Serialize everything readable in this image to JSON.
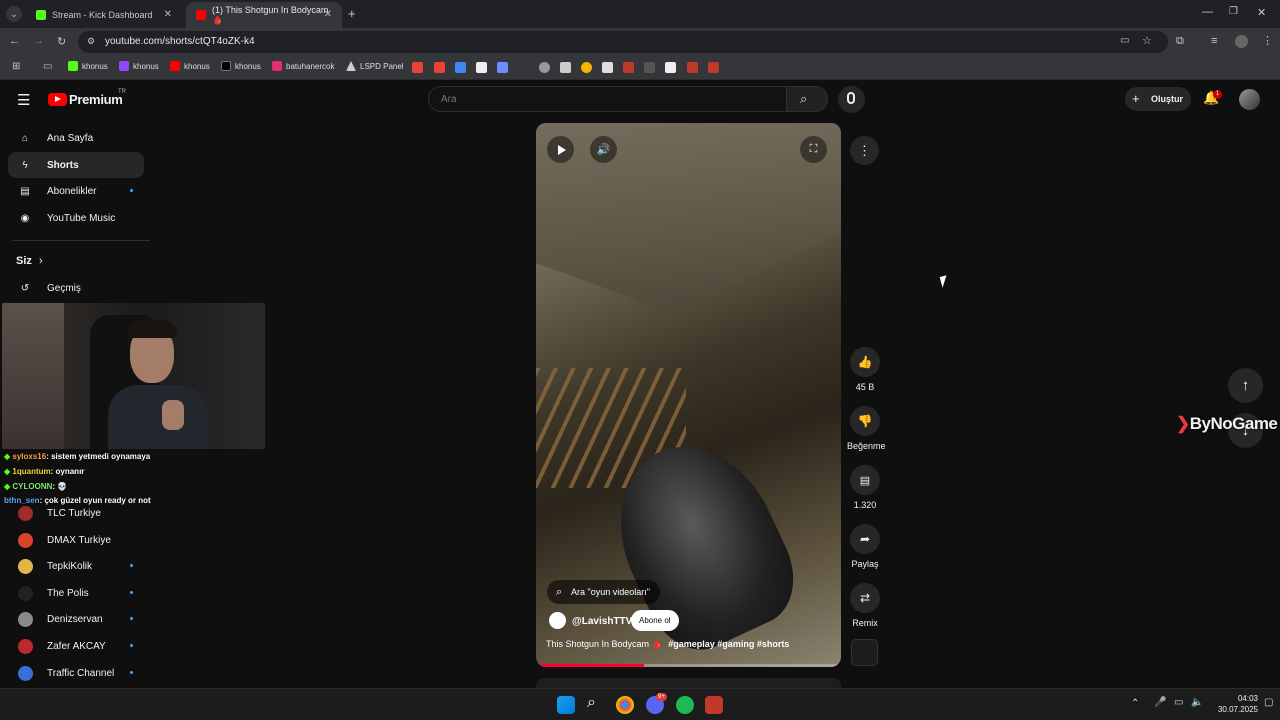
{
  "browser": {
    "tabs": [
      {
        "title": "Stream - Kick Dashboard",
        "color": "#53fc18"
      },
      {
        "title": "(1) This Shotgun In Bodycam 🩸",
        "color": "#ff0000"
      }
    ],
    "url": "youtube.com/shorts/ctQT4oZK-k4",
    "bookmarks": [
      "khonus",
      "khonus",
      "khonus",
      "khonus",
      "batuhanercok",
      "LSPD Panel"
    ]
  },
  "youtube": {
    "logo": "Premium",
    "logo_region": "TR",
    "search_placeholder": "Ara",
    "create_label": "Oluştur",
    "notif_count": "1",
    "sidebar": {
      "items": [
        {
          "label": "Ana Sayfa",
          "icon": "home-icon"
        },
        {
          "label": "Shorts",
          "icon": "shorts-icon"
        },
        {
          "label": "Abonelikler",
          "icon": "subscriptions-icon"
        },
        {
          "label": "YouTube Music",
          "icon": "music-icon"
        }
      ],
      "you_heading": "Siz",
      "history_label": "Geçmiş",
      "channels": [
        "TLC Turkiye",
        "DMAX Turkiye",
        "TepkiKolik",
        "The Polis",
        "Denizservan",
        "Zafer AKCAY",
        "Traffic Channel"
      ]
    },
    "short": {
      "search_chip": "Ara \"oyun videoları\"",
      "channel": "@LavishTTV",
      "subscribe_label": "Abone ol",
      "title": "This Shotgun In Bodycam 🩸",
      "hashtags": "#gameplay #gaming #shorts",
      "progress": 0.35
    },
    "actions": {
      "likes": "45 B",
      "dislike_label": "Beğenme",
      "comments": "1.320",
      "share_label": "Paylaş",
      "remix_label": "Remix"
    }
  },
  "overlay": {
    "chat": [
      {
        "user": "syloxs16",
        "msg": ": sistem yetmedi oynamaya",
        "color": "#ff9f43"
      },
      {
        "user": "1quantum",
        "msg": ": oynanır",
        "color": "#f5d442"
      },
      {
        "user": "CYLOONN",
        "msg": ": 💀",
        "color": "#7bed6f"
      },
      {
        "user": "bthn_sen",
        "msg": ": çok güzel oyun ready or not",
        "color": "#5aa7ff"
      }
    ],
    "watermark": "ByNoGame"
  },
  "taskbar": {
    "time": "04:03",
    "date": "30.07.2025",
    "discord_badge": "9+"
  }
}
